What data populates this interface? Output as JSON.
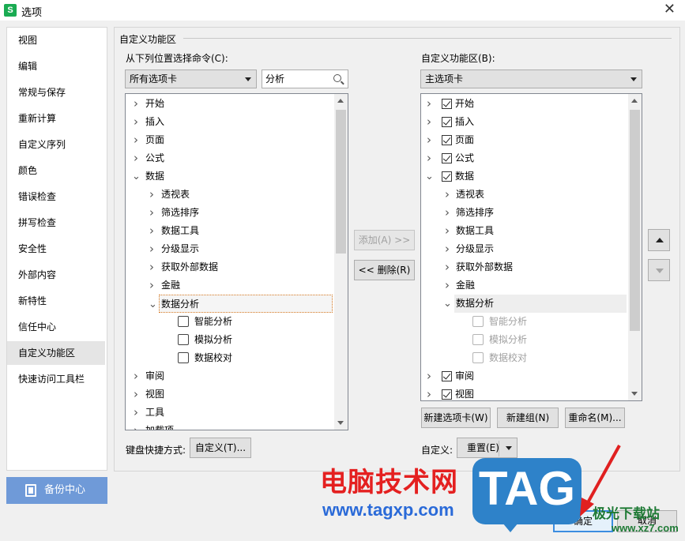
{
  "window": {
    "title": "选项",
    "app_icon_letter": "S"
  },
  "sidebar": {
    "items": [
      "视图",
      "编辑",
      "常规与保存",
      "重新计算",
      "自定义序列",
      "颜色",
      "错误检查",
      "拼写检查",
      "安全性",
      "外部内容",
      "新特性",
      "信任中心",
      "自定义功能区",
      "快速访问工具栏"
    ],
    "selected": "自定义功能区",
    "backup_label": "备份中心"
  },
  "main": {
    "section_title": "自定义功能区",
    "left": {
      "label": "从下列位置选择命令(C):",
      "combo_value": "所有选项卡",
      "search_value": "分析",
      "tree": {
        "top": [
          "开始",
          "插入",
          "页面",
          "公式"
        ],
        "data_group": "数据",
        "data_children": [
          "透视表",
          "筛选排序",
          "数据工具",
          "分级显示",
          "获取外部数据",
          "金融"
        ],
        "analysis": "数据分析",
        "analysis_children": [
          "智能分析",
          "模拟分析",
          "数据校对"
        ],
        "after": [
          "审阅",
          "视图",
          "工具",
          "加载项"
        ]
      },
      "keyboard_label": "键盘快捷方式:",
      "keyboard_button": "自定义(T)..."
    },
    "middle": {
      "add_button": "添加(A) >>",
      "remove_button": "<< 删除(R)"
    },
    "right": {
      "label": "自定义功能区(B):",
      "combo_value": "主选项卡",
      "tree": {
        "top": [
          "开始",
          "插入",
          "页面",
          "公式"
        ],
        "data_group": "数据",
        "data_children": [
          "透视表",
          "筛选排序",
          "数据工具",
          "分级显示",
          "获取外部数据",
          "金融"
        ],
        "analysis": "数据分析",
        "analysis_children": [
          "智能分析",
          "模拟分析",
          "数据校对"
        ],
        "after": [
          "审阅",
          "视图"
        ]
      },
      "new_tab_button": "新建选项卡(W)",
      "new_group_button": "新建组(N)",
      "rename_button": "重命名(M)...",
      "customize_label": "自定义:",
      "reset_button": "重置(E)"
    }
  },
  "footer": {
    "ok_button": "确定",
    "cancel_button": "取消"
  },
  "watermark": {
    "site_name": "电脑技术网",
    "url": "www.tagxp.com",
    "tag": "TAG",
    "xz_name": "极光下载站",
    "xz_url": "www.xz7.com"
  },
  "colors": {
    "accent": "#3c8de0",
    "backup_bg": "#6f9ad8",
    "watermark_red": "#e42020",
    "watermark_blue": "#2e82c9"
  }
}
